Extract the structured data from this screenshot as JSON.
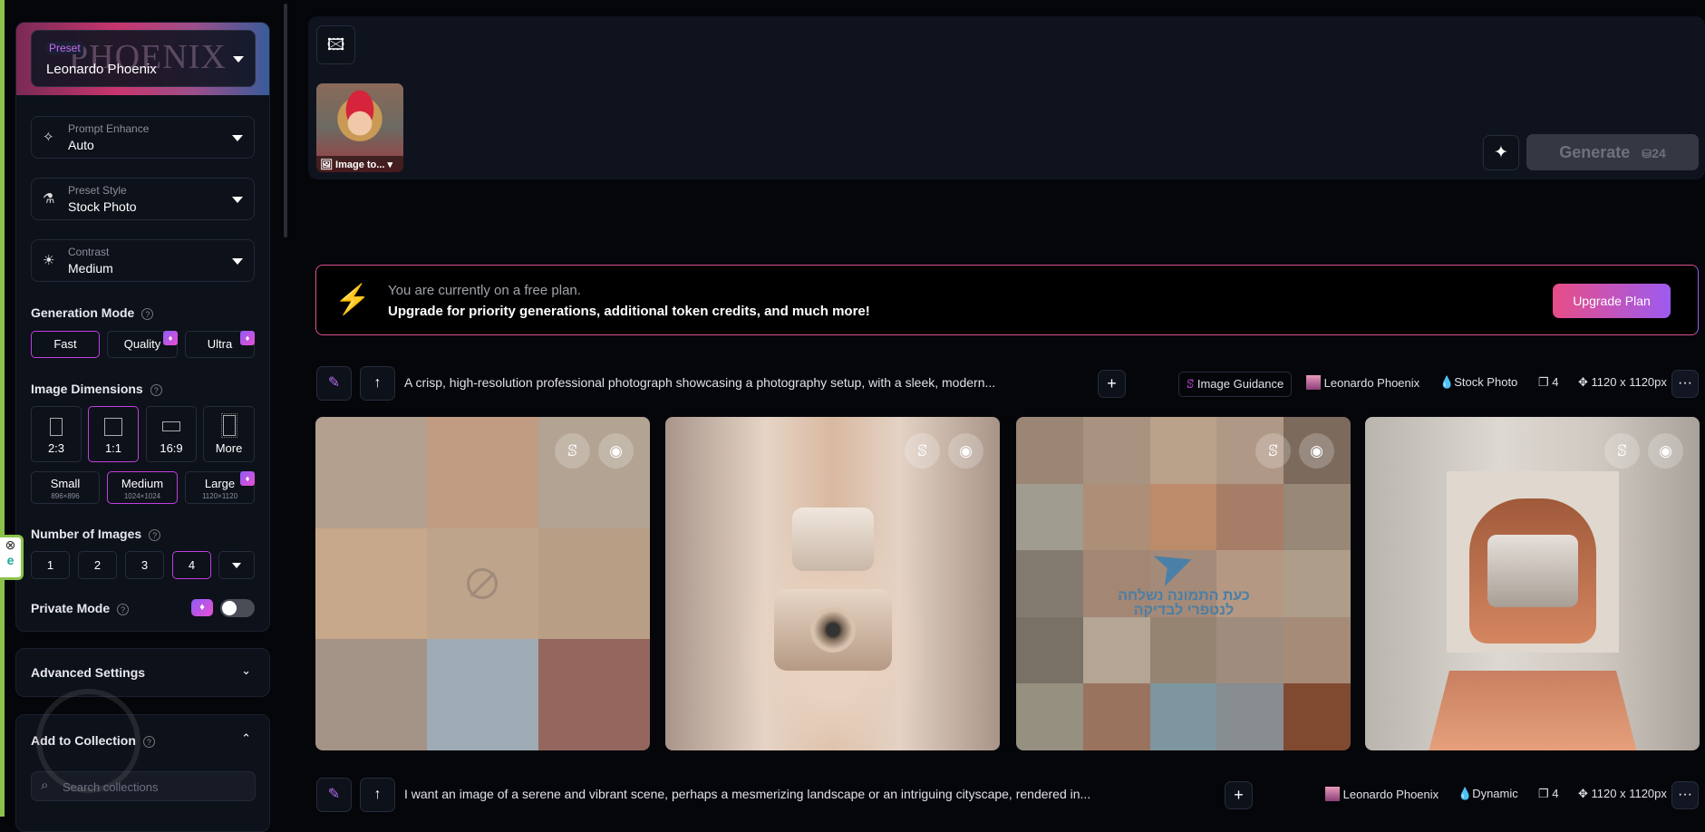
{
  "sidebar": {
    "preset": {
      "label": "Preset",
      "value": "Leonardo Phoenix",
      "watermark": "PHOENIX"
    },
    "prompt_enhance": {
      "label": "Prompt Enhance",
      "value": "Auto",
      "icon": "sparkles-icon"
    },
    "preset_style": {
      "label": "Preset Style",
      "value": "Stock Photo",
      "icon": "flask-icon"
    },
    "contrast": {
      "label": "Contrast",
      "value": "Medium",
      "icon": "sun-icon"
    },
    "generation_mode": {
      "title": "Generation Mode",
      "options": [
        "Fast",
        "Quality",
        "Ultra"
      ],
      "selected": "Fast"
    },
    "image_dimensions": {
      "title": "Image Dimensions",
      "aspects": [
        "2:3",
        "1:1",
        "16:9",
        "More"
      ],
      "selected_aspect": "1:1",
      "sizes": [
        {
          "label": "Small",
          "dims": "896×896"
        },
        {
          "label": "Medium",
          "dims": "1024×1024"
        },
        {
          "label": "Large",
          "dims": "1120×1120"
        }
      ],
      "selected_size": "Medium"
    },
    "number_of_images": {
      "title": "Number of Images",
      "options": [
        "1",
        "2",
        "3",
        "4"
      ],
      "selected": "4"
    },
    "private_mode": {
      "title": "Private Mode",
      "enabled": false
    },
    "advanced_settings": "Advanced Settings",
    "add_to_collection": {
      "title": "Add to Collection",
      "search_placeholder": "Search collections"
    }
  },
  "composer": {
    "thumbnail_label": "Image to...",
    "generate_label": "Generate",
    "token_cost": "24"
  },
  "banner": {
    "line1": "You are currently on a free plan.",
    "line2": "Upgrade for priority generations, additional token credits, and much more!",
    "button": "Upgrade Plan",
    "accent": "#e84d86"
  },
  "generations": [
    {
      "prompt": "A crisp, high-resolution professional photograph showcasing a photography setup, with a sleek, modern...",
      "guidance": "Image Guidance",
      "model": "Leonardo Phoenix",
      "style": "Stock Photo",
      "count": "4",
      "size": "1120 x 1120px"
    },
    {
      "prompt": "I want an image of a serene and vibrant scene, perhaps a mesmerizing landscape or an intriguing cityscape, rendered in...",
      "model": "Leonardo Phoenix",
      "style": "Dynamic",
      "count": "4",
      "size": "1120 x 1120px"
    }
  ],
  "filter_notice": "כעת התמונה נשלחה לנטפרי לבדיקה",
  "extension": {
    "close": "⊗",
    "logo": "e"
  }
}
